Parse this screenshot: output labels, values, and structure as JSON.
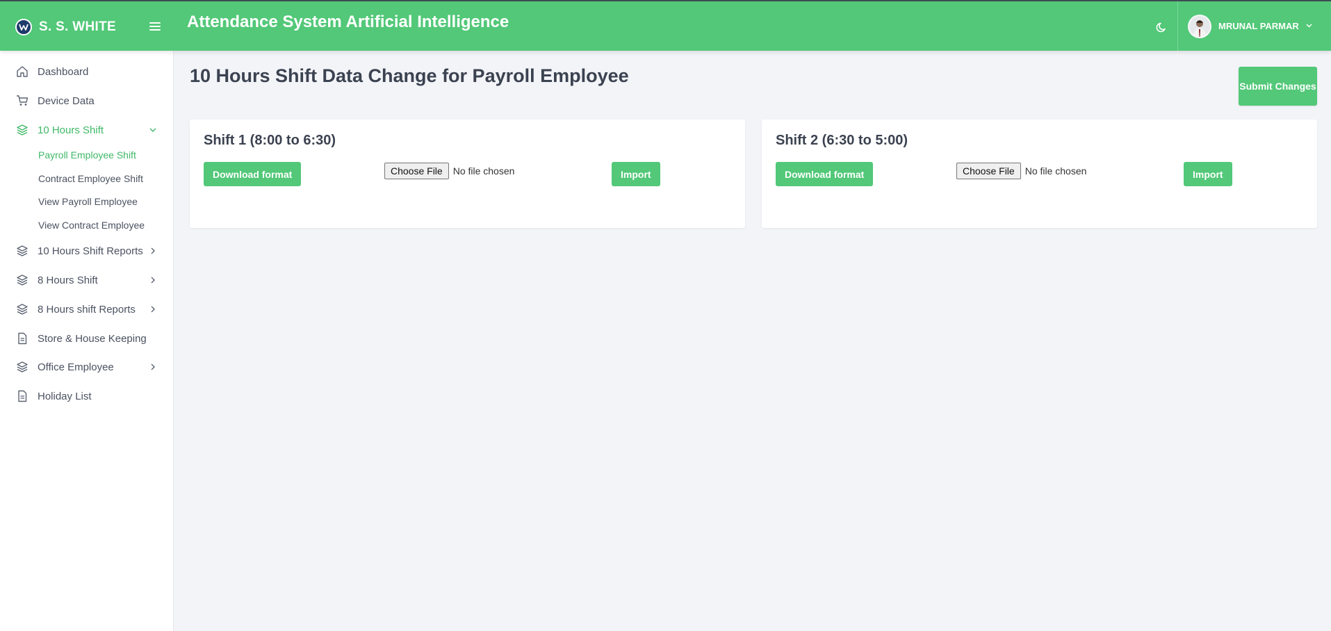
{
  "header": {
    "brand_name": "S. S. WHITE",
    "app_title": "Attendance System Artificial Intelligence",
    "user_name": "MRUNAL PARMAR",
    "accent_color": "#52c878",
    "icons": {
      "logo": "ssw-logo-icon",
      "menu": "hamburger-menu-icon",
      "theme": "moon-icon",
      "user_caret": "chevron-down-icon"
    }
  },
  "sidebar": {
    "items": [
      {
        "label": "Dashboard",
        "icon": "home-icon"
      },
      {
        "label": "Device Data",
        "icon": "cart-icon"
      },
      {
        "label": "10 Hours Shift",
        "icon": "layers-icon",
        "active": true,
        "expanded": true
      },
      {
        "label": "10 Hours Shift Reports",
        "icon": "layers-icon"
      },
      {
        "label": "8 Hours Shift",
        "icon": "layers-icon"
      },
      {
        "label": "8 Hours shift Reports",
        "icon": "layers-icon"
      },
      {
        "label": "Store & House Keeping",
        "icon": "file-icon"
      },
      {
        "label": "Office Employee",
        "icon": "layers-icon"
      },
      {
        "label": "Holiday List",
        "icon": "file-icon"
      }
    ],
    "subitems": [
      {
        "label": "Payroll Employee Shift",
        "active": true
      },
      {
        "label": "Contract Employee Shift"
      },
      {
        "label": "View Payroll Employee"
      },
      {
        "label": "View Contract Employee"
      }
    ]
  },
  "main": {
    "page_title": "10 Hours Shift Data Change for Payroll Employee",
    "submit_label": "Submit Changes",
    "cards": [
      {
        "title": "Shift 1 (8:00 to 6:30)",
        "download_label": "Download format",
        "choose_file_label": "Choose File",
        "file_status": "No file chosen",
        "import_label": "Import"
      },
      {
        "title": "Shift 2 (6:30 to 5:00)",
        "download_label": "Download format",
        "choose_file_label": "Choose File",
        "file_status": "No file chosen",
        "import_label": "Import"
      }
    ]
  }
}
